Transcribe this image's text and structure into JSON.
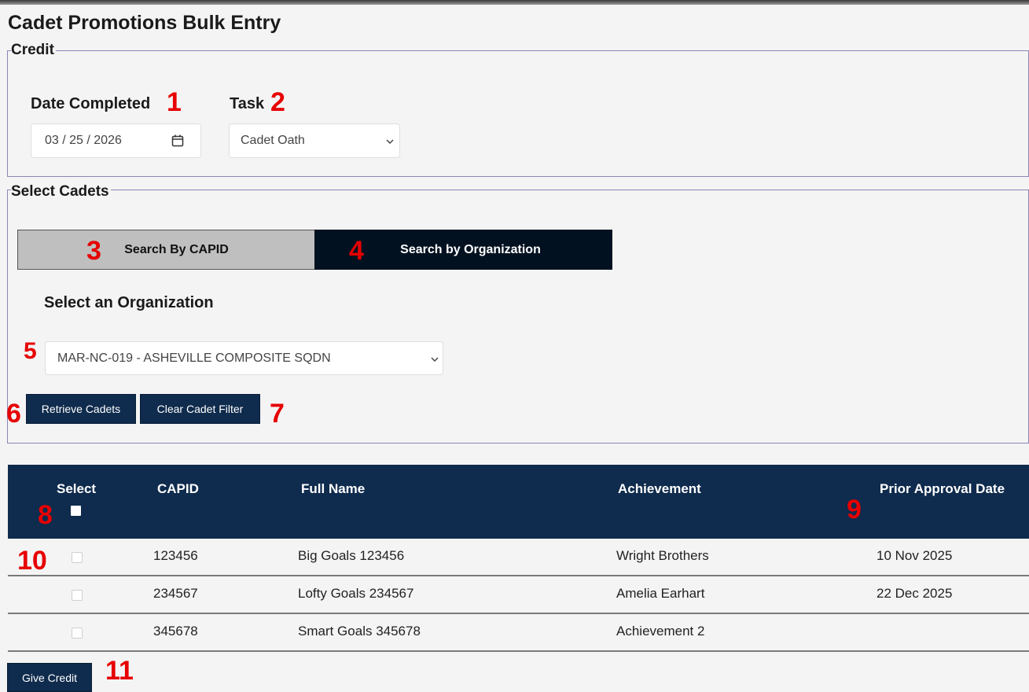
{
  "page": {
    "title": "Cadet Promotions Bulk Entry"
  },
  "credit": {
    "legend": "Credit",
    "date_label": "Date Completed",
    "date_value": "03 / 25 / 2026",
    "task_label": "Task",
    "task_value": "Cadet Oath"
  },
  "select_cadets": {
    "legend": "Select Cadets",
    "tab_capid": "Search By CAPID",
    "tab_org": "Search by Organization",
    "org_label": "Select an Organization",
    "org_value": "MAR-NC-019 - ASHEVILLE COMPOSITE SQDN",
    "retrieve_label": "Retrieve Cadets",
    "clear_label": "Clear Cadet Filter"
  },
  "table": {
    "headers": [
      "Select",
      "CAPID",
      "Full Name",
      "Achievement",
      "Prior Approval Date"
    ],
    "rows": [
      {
        "capid": "123456",
        "name": "Big Goals 123456",
        "achievement": "Wright Brothers",
        "date": "10 Nov 2025"
      },
      {
        "capid": "234567",
        "name": "Lofty Goals 234567",
        "achievement": "Amelia Earhart",
        "date": "22 Dec 2025"
      },
      {
        "capid": "345678",
        "name": "Smart Goals 345678",
        "achievement": "Achievement 2",
        "date": ""
      }
    ]
  },
  "footer": {
    "give_credit_label": "Give Credit"
  },
  "markers": [
    "1",
    "2",
    "3",
    "4",
    "5",
    "6",
    "7",
    "8",
    "9",
    "10",
    "11"
  ],
  "colors": {
    "navy": "#0f2b4d",
    "tab_dark": "#021120",
    "tab_light": "#bfbfbf",
    "marker_red": "#e60000",
    "fieldset_border": "#8a86b8"
  },
  "icons": {
    "date_icon": "calendar-icon",
    "select_icon": "chevron-down-icon"
  }
}
